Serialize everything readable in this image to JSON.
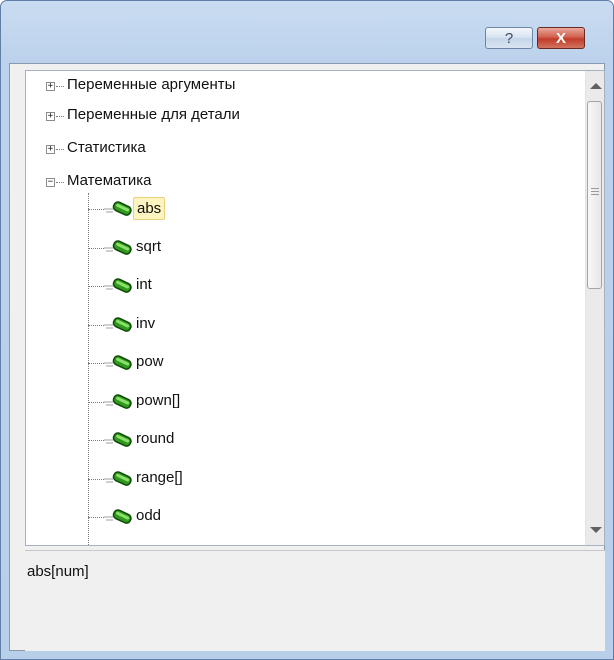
{
  "titlebar": {
    "help_label": "?",
    "close_label": "X"
  },
  "tree": {
    "categories": [
      {
        "label": "Переменные аргументы",
        "state": "+"
      },
      {
        "label": "Переменные для детали",
        "state": "+"
      },
      {
        "label": "Статистика",
        "state": "+"
      },
      {
        "label": "Математика",
        "state": "−"
      }
    ],
    "functions": [
      {
        "label": "abs",
        "selected": true
      },
      {
        "label": "sqrt"
      },
      {
        "label": "int"
      },
      {
        "label": "inv"
      },
      {
        "label": "pow"
      },
      {
        "label": "pown[]"
      },
      {
        "label": "round"
      },
      {
        "label": "range[]"
      },
      {
        "label": "odd"
      }
    ]
  },
  "description": {
    "signature": "abs[num]"
  },
  "colors": {
    "selection_bg": "#fdf4bf",
    "icon_green": "#2f9a1c"
  }
}
